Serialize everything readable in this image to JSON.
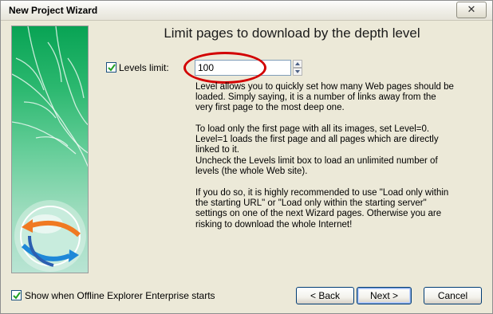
{
  "window": {
    "title": "New Project Wizard",
    "close_icon": "close-icon"
  },
  "wizard": {
    "heading": "Limit pages to download by the depth level",
    "levels_limit": {
      "label": "Levels limit:",
      "checked": true,
      "value": "100"
    },
    "description": {
      "para1": [
        "Level allows you to quickly set how many Web pages should be",
        "loaded. Simply saying, it is a number of links away from the",
        "very first page to the most deep one."
      ],
      "para2": [
        "To load only the first page with all its images, set Level=0.",
        "Level=1 loads the first page and all pages which are directly",
        "linked to it.",
        "Uncheck the Levels limit box to load an unlimited number of",
        "levels (the whole Web site)."
      ],
      "para3": [
        "If you do so, it is highly recommended to use \"Load only within",
        "the starting URL\" or \"Load only within the starting server\"",
        "settings on one of the next Wizard pages. Otherwise you are",
        "risking to download the whole Internet!"
      ]
    }
  },
  "footer": {
    "show_on_start_label": "Show when Offline Explorer Enterprise starts",
    "show_on_start_checked": true,
    "back_label": "< Back",
    "next_label": "Next >",
    "cancel_label": "Cancel"
  },
  "colors": {
    "accent_panel": "#08a354",
    "highlight_ellipse": "#d20000",
    "dialog_bg": "#ece9d8"
  }
}
